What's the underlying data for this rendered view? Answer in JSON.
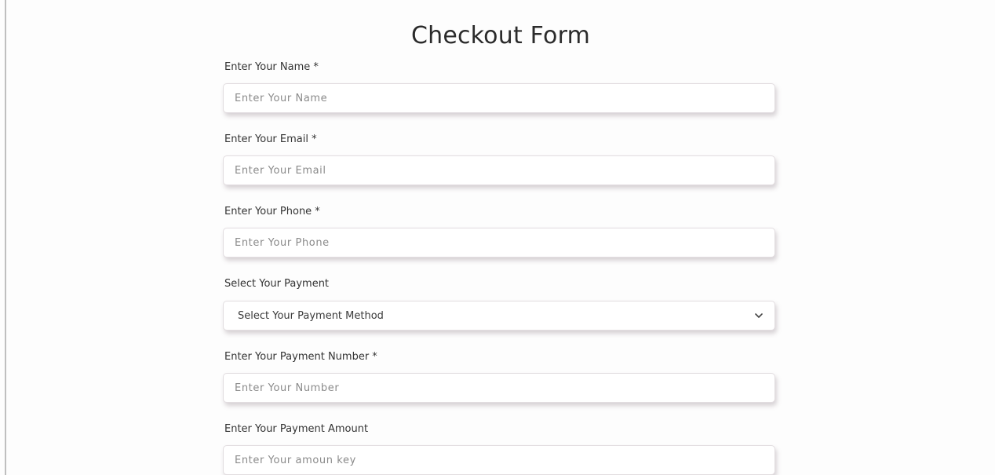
{
  "form": {
    "title": "Checkout Form",
    "fields": [
      {
        "label": "Enter Your Name *",
        "placeholder": "Enter Your Name",
        "value": ""
      },
      {
        "label": "Enter Your Email *",
        "placeholder": "Enter Your Email",
        "value": ""
      },
      {
        "label": "Enter Your Phone *",
        "placeholder": "Enter Your Phone",
        "value": ""
      }
    ],
    "payment_select": {
      "label": "Select Your Payment",
      "selected": "Select Your Payment Method",
      "icon": "chevron-down-icon"
    },
    "payment_number": {
      "label": "Enter Your Payment Number *",
      "placeholder": "Enter Your Number",
      "value": ""
    },
    "payment_amount": {
      "label": "Enter Your Payment Amount",
      "placeholder": "Enter Your amoun key",
      "value": ""
    }
  },
  "colors": {
    "background": "#fdfdfd",
    "title": "#2b2b2b",
    "label": "#333333",
    "placeholder": "#8a8a8a",
    "input_border": "#e2dde0"
  }
}
